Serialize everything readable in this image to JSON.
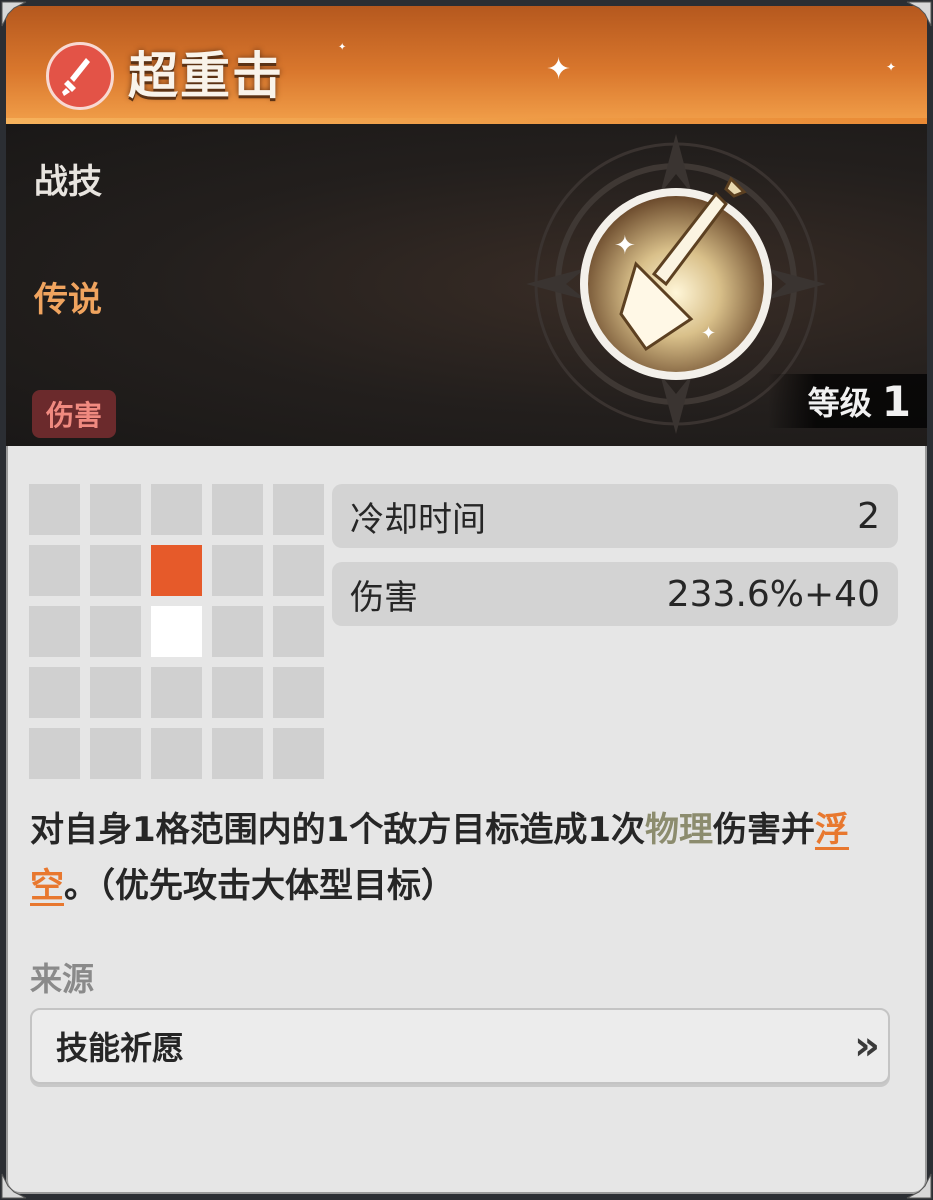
{
  "skill": {
    "name": "超重击",
    "type": "战技",
    "rarity": "传说",
    "tag": "伤害",
    "level_label": "等级",
    "level_value": "1"
  },
  "stats": [
    {
      "label": "冷却时间",
      "value": "2"
    },
    {
      "label": "伤害",
      "value": "233.6%+40"
    }
  ],
  "range_grid": {
    "size": 5,
    "target_cell": [
      1,
      2
    ],
    "self_cell": [
      2,
      2
    ]
  },
  "description": {
    "part1": "对自身1格范围内的1个敌方目标造成1次",
    "physical": "物理",
    "part2": "伤害并",
    "float": "浮空",
    "part3": "。（优先攻击大体型目标）"
  },
  "source": {
    "label": "来源",
    "button": "技能祈愿",
    "arrow": "»"
  },
  "colors": {
    "header": "#d9772d",
    "target": "#e65a2a",
    "rarity": "#f0a45f",
    "tag_bg": "#6b2a2c"
  }
}
